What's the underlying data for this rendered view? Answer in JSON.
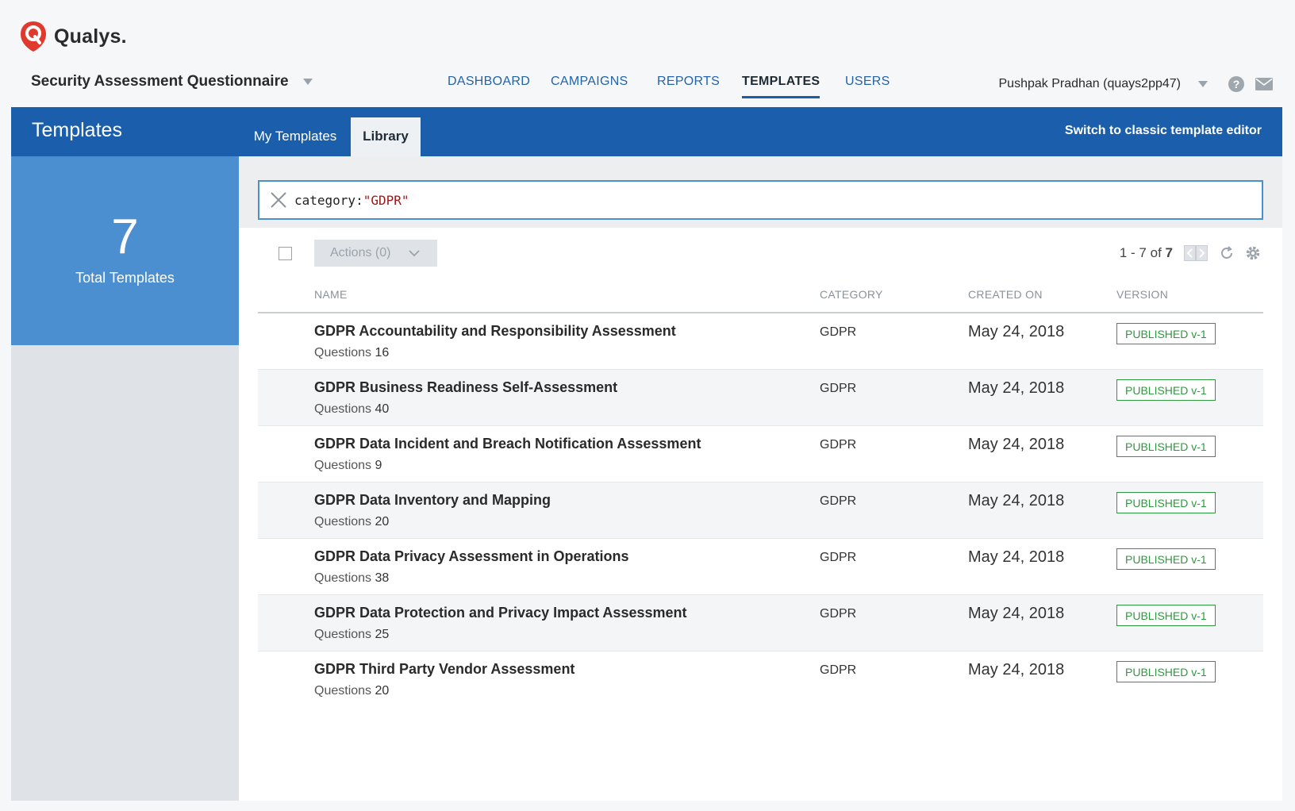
{
  "brand": {
    "name": "Qualys.",
    "accent": "#e03a2f"
  },
  "app": {
    "title": "Security Assessment Questionnaire"
  },
  "nav": {
    "items": [
      {
        "label": "DASHBOARD",
        "active": false
      },
      {
        "label": "CAMPAIGNS",
        "active": false
      },
      {
        "label": "REPORTS",
        "active": false
      },
      {
        "label": "TEMPLATES",
        "active": true
      },
      {
        "label": "USERS",
        "active": false
      }
    ]
  },
  "user": {
    "name": "Pushpak Pradhan (quays2pp47)",
    "help_glyph": "?"
  },
  "bar": {
    "title": "Templates",
    "tabs": [
      {
        "label": "My Templates",
        "active": false
      },
      {
        "label": "Library",
        "active": true
      }
    ],
    "classic_link": "Switch to classic template editor",
    "color": "#1b5fac"
  },
  "summary": {
    "count": "7",
    "label": "Total Templates",
    "color": "#4b8fd1"
  },
  "search": {
    "key": "category:",
    "value": "\"GDPR\""
  },
  "toolbar": {
    "actions_label": "Actions (0)",
    "pager_range": "1 - 7 of",
    "pager_total": "7"
  },
  "table": {
    "columns": {
      "name": "NAME",
      "category": "CATEGORY",
      "created_on": "CREATED ON",
      "version": "VERSION"
    },
    "questions_label": "Questions",
    "rows": [
      {
        "name": "GDPR Accountability and Responsibility Assessment",
        "questions": "16",
        "category": "GDPR",
        "created": "May 24, 2018",
        "version": "PUBLISHED v-1"
      },
      {
        "name": "GDPR Business Readiness Self-Assessment",
        "questions": "40",
        "category": "GDPR",
        "created": "May 24, 2018",
        "version": "PUBLISHED v-1"
      },
      {
        "name": "GDPR Data Incident and Breach Notification Assessment",
        "questions": "9",
        "category": "GDPR",
        "created": "May 24, 2018",
        "version": "PUBLISHED v-1"
      },
      {
        "name": "GDPR Data Inventory and Mapping",
        "questions": "20",
        "category": "GDPR",
        "created": "May 24, 2018",
        "version": "PUBLISHED v-1"
      },
      {
        "name": "GDPR Data Privacy Assessment in Operations",
        "questions": "38",
        "category": "GDPR",
        "created": "May 24, 2018",
        "version": "PUBLISHED v-1"
      },
      {
        "name": "GDPR Data Protection and Privacy Impact Assessment",
        "questions": "25",
        "category": "GDPR",
        "created": "May 24, 2018",
        "version": "PUBLISHED v-1"
      },
      {
        "name": "GDPR Third Party Vendor Assessment",
        "questions": "20",
        "category": "GDPR",
        "created": "May 24, 2018",
        "version": "PUBLISHED v-1"
      }
    ]
  }
}
